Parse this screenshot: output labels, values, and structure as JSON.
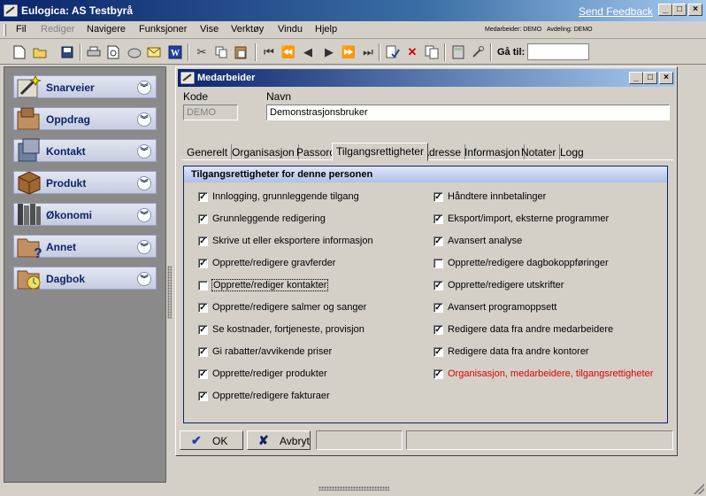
{
  "app": {
    "title": "Eulogica: AS Testbyrå",
    "feedback_link": "Send Feedback",
    "win_min": "_",
    "win_max": "□",
    "win_close": "×"
  },
  "menu": {
    "items": [
      "Fil",
      "Rediger",
      "Navigere",
      "Funksjoner",
      "Vise",
      "Verktøy",
      "Vindu",
      "Hjelp"
    ],
    "disabled": [
      "Rediger"
    ],
    "status_user": "Medarbeider: DEMO",
    "status_dept": "Avdeling: DEMO"
  },
  "toolbar": {
    "goto_label": "Gå til:",
    "goto_value": ""
  },
  "sidebar": {
    "items": [
      {
        "label": "Snarveier",
        "icon": "shortcut-wand-icon"
      },
      {
        "label": "Oppdrag",
        "icon": "folder-icon"
      },
      {
        "label": "Kontakt",
        "icon": "contact-box-icon"
      },
      {
        "label": "Produkt",
        "icon": "product-box-icon"
      },
      {
        "label": "Økonomi",
        "icon": "ledger-books-icon"
      },
      {
        "label": "Annet",
        "icon": "question-folder-icon"
      },
      {
        "label": "Dagbok",
        "icon": "diary-clock-icon"
      }
    ]
  },
  "dialog": {
    "title": "Medarbeider",
    "kode_label": "Kode",
    "kode_value": "DEMO",
    "navn_label": "Navn",
    "navn_value": "Demonstrasjonsbruker",
    "tabs": [
      "Generelt",
      "Organisasjon",
      "Passord",
      "Tilgangsrettigheter",
      "Adresse",
      "Informasjon",
      "Notater",
      "Logg"
    ],
    "active_tab": "Tilgangsrettigheter",
    "panel_title": "Tilgangsrettigheter for denne personen",
    "left_permissions": [
      {
        "label": "Innlogging, grunnleggende tilgang",
        "checked": true
      },
      {
        "label": "Grunnleggende redigering",
        "checked": true
      },
      {
        "label": "Skrive ut eller eksportere informasjon",
        "checked": true
      },
      {
        "label": "Opprette/redigere gravferder",
        "checked": true
      },
      {
        "label": "Opprette/rediger kontakter",
        "checked": false
      },
      {
        "label": "Opprette/redigere salmer og sanger",
        "checked": true
      },
      {
        "label": "Se kostnader, fortjeneste, provisjon",
        "checked": true
      },
      {
        "label": "Gi rabatter/avvikende priser",
        "checked": true
      },
      {
        "label": "Opprette/rediger produkter",
        "checked": true
      },
      {
        "label": "Opprette/redigere fakturaer",
        "checked": true
      }
    ],
    "right_permissions": [
      {
        "label": "Håndtere innbetalinger",
        "checked": true
      },
      {
        "label": "Eksport/import, eksterne programmer",
        "checked": true
      },
      {
        "label": "Avansert analyse",
        "checked": true
      },
      {
        "label": "Opprette/redigere dagbokoppføringer",
        "checked": false
      },
      {
        "label": "Opprette/redigere utskrifter",
        "checked": true
      },
      {
        "label": "Avansert programoppsett",
        "checked": true
      },
      {
        "label": "Redigere data fra andre medarbeidere",
        "checked": true
      },
      {
        "label": "Redigere data fra andre kontorer",
        "checked": true
      },
      {
        "label": "Organisasjon, medarbeidere, tilgangsrettigheter",
        "checked": true,
        "red": true
      }
    ],
    "ok_label": "OK",
    "cancel_label": "Avbryt",
    "check_mark": "✓",
    "ok_icon": "✔",
    "cancel_icon": "✘"
  },
  "colors": {
    "title_bar": "#0a246a",
    "sidebar_label": "#0a246a",
    "warning_text": "#e00000"
  }
}
